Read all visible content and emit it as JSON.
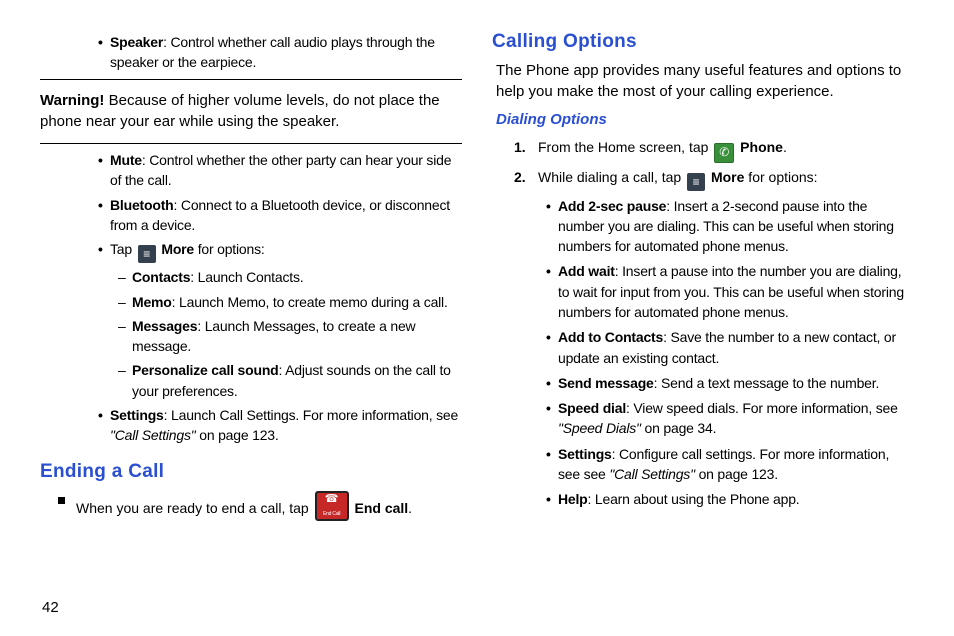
{
  "left": {
    "speaker": {
      "term": "Speaker",
      "desc": ": Control whether call audio plays through the speaker or the earpiece."
    },
    "warning": {
      "lead": "Warning!",
      "text": " Because of higher volume levels, do not place the phone near your ear while using the speaker."
    },
    "mute": {
      "term": "Mute",
      "desc": ": Control whether the other party can hear your side of the call."
    },
    "bluetooth": {
      "term": "Bluetooth",
      "desc": ": Connect to a Bluetooth device, or disconnect from a device."
    },
    "tap_more": {
      "pre": "Tap ",
      "label": " More",
      "post": " for options:"
    },
    "more_opts": {
      "contacts": {
        "term": "Contacts",
        "desc": ": Launch Contacts."
      },
      "memo": {
        "term": "Memo",
        "desc": ": Launch Memo, to create memo during a call."
      },
      "messages": {
        "term": "Messages",
        "desc": ": Launch Messages, to create a new message."
      },
      "personalize": {
        "term": "Personalize call sound",
        "desc": ": Adjust sounds on the call to your preferences."
      }
    },
    "settings": {
      "term": "Settings",
      "desc": ": Launch Call Settings. For more information, see ",
      "ref": "\"Call Settings\"",
      "tail": " on page 123."
    },
    "ending_heading": "Ending a Call",
    "ending": {
      "pre": "When you are ready to end a call, tap ",
      "label": " End call",
      "post": "."
    }
  },
  "right": {
    "heading": "Calling Options",
    "intro": "The Phone app provides many useful features and options to help you make the most of your calling experience.",
    "sub": "Dialing Options",
    "step1": {
      "num": "1.",
      "pre": "From the Home screen, tap ",
      "label": " Phone",
      "post": "."
    },
    "step2": {
      "num": "2.",
      "pre": "While dialing a call, tap ",
      "label": " More",
      "post": " for options:"
    },
    "opts": {
      "pause": {
        "term": "Add 2-sec pause",
        "desc": ": Insert a 2-second pause into the number you are dialing. This can be useful when storing numbers for automated phone menus."
      },
      "wait": {
        "term": "Add wait",
        "desc": ": Insert a pause into the number you are dialing, to wait for input from you. This can be useful when storing numbers for automated phone menus."
      },
      "contacts": {
        "term": "Add to Contacts",
        "desc": ": Save the number to a new contact, or update an existing contact."
      },
      "send": {
        "term": "Send message",
        "desc": ": Send a text message to the number."
      },
      "speed": {
        "term": "Speed dial",
        "desc": ": View speed dials. For more information, see ",
        "ref": "\"Speed Dials\"",
        "tail": " on page 34."
      },
      "settings": {
        "term": "Settings",
        "desc": ": Configure call settings. For more information, see see ",
        "ref": "\"Call Settings\"",
        "tail": " on page 123."
      },
      "help": {
        "term": "Help",
        "desc": ": Learn about using the Phone app."
      }
    }
  },
  "page_number": "42"
}
